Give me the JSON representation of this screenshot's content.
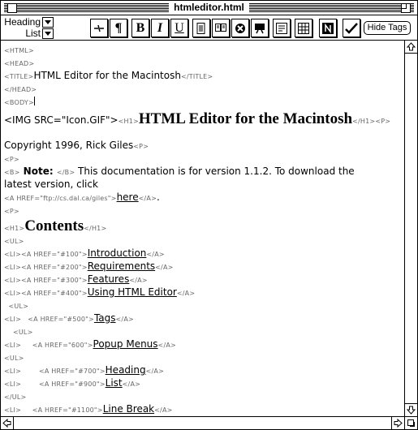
{
  "window": {
    "title": "htmleditor.html"
  },
  "toolbar": {
    "heading_label": "Heading",
    "list_label": "List",
    "hide_tags_label": "Hide Tags",
    "buttons": {
      "bold": "B",
      "italic": "I",
      "underline": "U"
    },
    "icons": [
      "no-break-icon",
      "paragraph-icon",
      "bold-icon",
      "italic-icon",
      "underline-icon",
      "document-icon",
      "book-icon",
      "anchor-icon",
      "image-icon",
      "form-icon",
      "table-icon",
      "netscape-icon",
      "checkmark-icon"
    ]
  },
  "document": {
    "lines": [
      {
        "name": "line-html",
        "segs": [
          {
            "c": "t",
            "v": "<HTML>"
          }
        ]
      },
      {
        "name": "line-head",
        "segs": [
          {
            "c": "t",
            "v": "<HEAD>"
          }
        ]
      },
      {
        "name": "line-title",
        "segs": [
          {
            "c": "t",
            "v": "<TITLE>"
          },
          {
            "c": "x",
            "v": "HTML Editor for the Macintosh"
          },
          {
            "c": "t",
            "v": "</TITLE>"
          }
        ]
      },
      {
        "name": "line-head-close",
        "segs": [
          {
            "c": "t",
            "v": "</HEAD>"
          }
        ]
      },
      {
        "name": "line-body",
        "segs": [
          {
            "c": "t",
            "v": "<BODY>"
          },
          {
            "c": "caret",
            "v": ""
          }
        ]
      },
      {
        "name": "line-img-h1",
        "segs": [
          {
            "c": "x",
            "v": "<IMG SRC=\"Icon.GIF\">"
          },
          {
            "c": "t",
            "v": "<H1>"
          },
          {
            "c": "big",
            "v": "HTML Editor for the Macintosh"
          },
          {
            "c": "t",
            "v": "</H1><P>"
          }
        ]
      },
      {
        "name": "line-copyright",
        "segs": [
          {
            "c": "x",
            "v": "Copyright 1996, Rick Giles"
          },
          {
            "c": "t",
            "v": "<P>"
          }
        ]
      },
      {
        "name": "line-p1",
        "segs": [
          {
            "c": "t",
            "v": "<P>"
          }
        ]
      },
      {
        "name": "line-note",
        "segs": [
          {
            "c": "t",
            "v": "<B>"
          },
          {
            "c": "xb",
            "v": " Note: "
          },
          {
            "c": "t",
            "v": "</B>"
          },
          {
            "c": "x",
            "v": " This documentation is for version 1.1.2. To download the"
          }
        ]
      },
      {
        "name": "line-note-cont",
        "segs": [
          {
            "c": "x",
            "v": "latest version, click"
          }
        ]
      },
      {
        "name": "line-ftp",
        "segs": [
          {
            "c": "t",
            "v": "<A HREF=\"ftp://cs.dal.ca/giles\">"
          },
          {
            "c": "xu",
            "v": "here"
          },
          {
            "c": "t",
            "v": "</A>"
          },
          {
            "c": "x",
            "v": "."
          }
        ]
      },
      {
        "name": "line-p2",
        "segs": [
          {
            "c": "t",
            "v": "<P>"
          }
        ]
      },
      {
        "name": "line-contents",
        "segs": [
          {
            "c": "t",
            "v": "<H1>"
          },
          {
            "c": "big",
            "v": "Contents"
          },
          {
            "c": "t",
            "v": "</H1>"
          }
        ]
      },
      {
        "name": "line-ul1",
        "segs": [
          {
            "c": "t",
            "v": "<UL>"
          }
        ]
      },
      {
        "name": "line-li-intro",
        "segs": [
          {
            "c": "t",
            "v": "<LI><A HREF=\"#100\">"
          },
          {
            "c": "xu",
            "v": "Introduction"
          },
          {
            "c": "t",
            "v": "</A>"
          }
        ]
      },
      {
        "name": "line-li-req",
        "segs": [
          {
            "c": "t",
            "v": "<LI><A HREF=\"#200\">"
          },
          {
            "c": "xu",
            "v": "Requirements"
          },
          {
            "c": "t",
            "v": "</A>"
          }
        ]
      },
      {
        "name": "line-li-feat",
        "segs": [
          {
            "c": "t",
            "v": "<LI><A HREF=\"#300\">"
          },
          {
            "c": "xu",
            "v": "Features"
          },
          {
            "c": "t",
            "v": "</A>"
          }
        ]
      },
      {
        "name": "line-li-using",
        "segs": [
          {
            "c": "t",
            "v": "<LI><A HREF=\"#400\">"
          },
          {
            "c": "xu",
            "v": "Using HTML Editor"
          },
          {
            "c": "t",
            "v": "</A>"
          }
        ]
      },
      {
        "name": "line-ul2",
        "segs": [
          {
            "c": "t",
            "v": "  <UL>"
          }
        ]
      },
      {
        "name": "line-li-tags",
        "segs": [
          {
            "c": "t",
            "v": "<LI>   <A HREF=\"#500\">"
          },
          {
            "c": "xu",
            "v": "Tags"
          },
          {
            "c": "t",
            "v": "</A>"
          }
        ]
      },
      {
        "name": "line-ul3",
        "segs": [
          {
            "c": "t",
            "v": "    <UL>"
          }
        ]
      },
      {
        "name": "line-li-popup",
        "segs": [
          {
            "c": "t",
            "v": "<LI>     <A HREF=\"600\">"
          },
          {
            "c": "xu",
            "v": "Popup Menus"
          },
          {
            "c": "t",
            "v": "</A>"
          }
        ]
      },
      {
        "name": "line-ul4",
        "segs": [
          {
            "c": "t",
            "v": "<UL>"
          }
        ]
      },
      {
        "name": "line-li-heading",
        "segs": [
          {
            "c": "t",
            "v": "<LI>        <A HREF=\"#700\">"
          },
          {
            "c": "xu",
            "v": "Heading"
          },
          {
            "c": "t",
            "v": "</A>"
          }
        ]
      },
      {
        "name": "line-li-list",
        "segs": [
          {
            "c": "t",
            "v": "<LI>        <A HREF=\"#900\">"
          },
          {
            "c": "xu",
            "v": "List"
          },
          {
            "c": "t",
            "v": "</A>"
          }
        ]
      },
      {
        "name": "line-ul-close",
        "segs": [
          {
            "c": "t",
            "v": "</UL>"
          }
        ]
      },
      {
        "name": "line-li-linebreak",
        "segs": [
          {
            "c": "t",
            "v": "<LI>     <A HREF=\"#1100\">"
          },
          {
            "c": "xu",
            "v": "Line Break"
          },
          {
            "c": "t",
            "v": "</A>"
          }
        ]
      }
    ]
  }
}
